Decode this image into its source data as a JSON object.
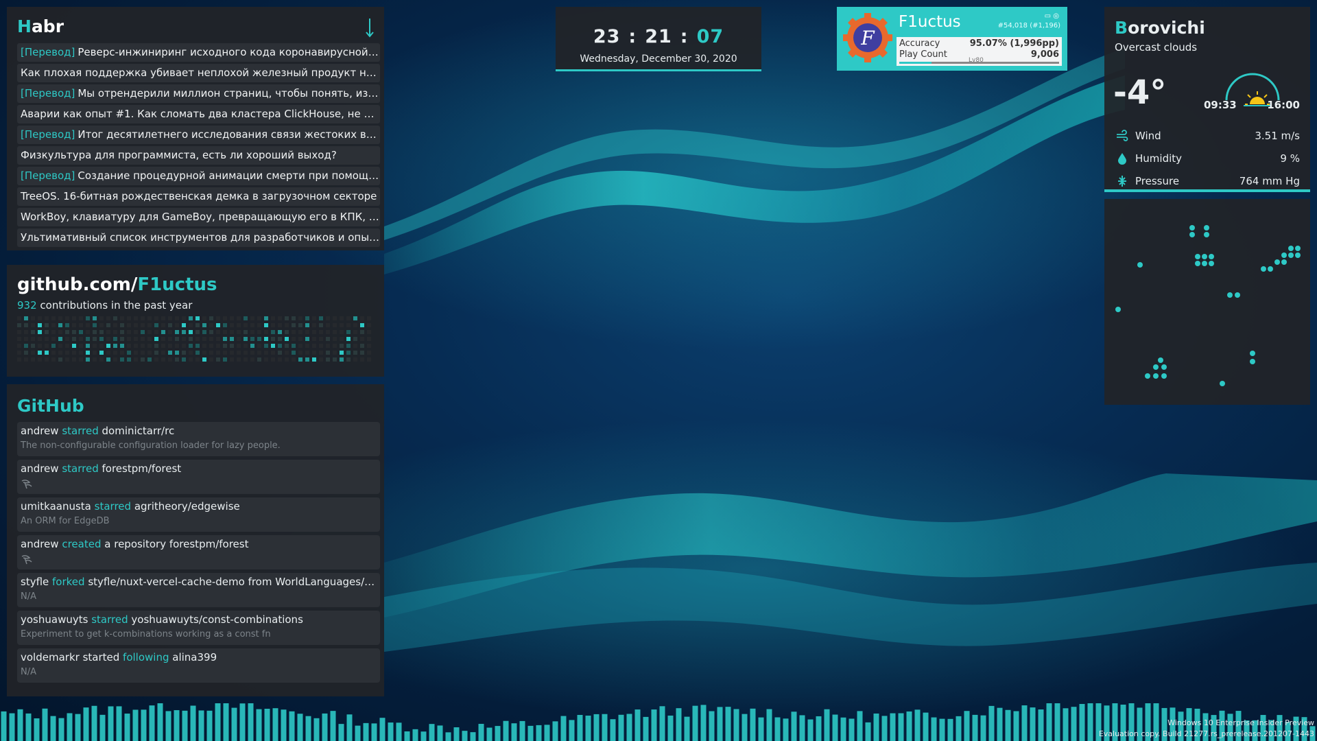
{
  "colors": {
    "accent": "#2ec9c6",
    "panel": "#212428",
    "item": "#2e3237",
    "muted": "#7d848a"
  },
  "habr": {
    "title_first": "H",
    "title_rest": "abr",
    "arrow_icon": "arrow-down-icon",
    "items": [
      {
        "tag": "[Перевод]",
        "text": "Реверс-инжиниринг исходного кода коронавирусной ва..."
      },
      {
        "tag": "",
        "text": "Как плохая поддержка убивает неплохой железный продукт на пр..."
      },
      {
        "tag": "[Перевод]",
        "text": "Мы отрендерили миллион страниц, чтобы понять, из-з..."
      },
      {
        "tag": "",
        "text": "Аварии как опыт #1. Как сломать два кластера ClickHouse, не уточ..."
      },
      {
        "tag": "[Перевод]",
        "text": "Итог десятилетнего исследования связи жестоких вид..."
      },
      {
        "tag": "",
        "text": "Физкультура для программиста, есть ли хороший выход?"
      },
      {
        "tag": "[Перевод]",
        "text": "Создание процедурной анимации смерти при помощи..."
      },
      {
        "tag": "",
        "text": "TreeOS. 16-битная рождественская демка в загрузочном секторе"
      },
      {
        "tag": "",
        "text": "WorkBoy, клавиатуру для GameBoy, превращающую его в КПК, на..."
      },
      {
        "tag": "",
        "text": "Ультимативный список инструментов для разработчиков и опытн..."
      }
    ]
  },
  "github_contrib": {
    "domain": "github.com/",
    "user": "F1uctus",
    "count": "932",
    "suffix": " contributions in the past year"
  },
  "github_feed": {
    "title_first": "Git",
    "title_second": "H",
    "title_rest": "ub",
    "items": [
      {
        "actor": "andrew",
        "verb": "starred",
        "target": "dominictarr/rc",
        "desc": "The non-configurable configuration loader for lazy people.",
        "icon": ""
      },
      {
        "actor": "andrew",
        "verb": "starred",
        "target": "forestpm/forest",
        "desc": "",
        "icon": "tree-icon"
      },
      {
        "actor": "umitkaanusta",
        "verb": "starred",
        "target": "agritheory/edgewise",
        "desc": "An ORM for EdgeDB",
        "icon": ""
      },
      {
        "actor": "andrew",
        "verb": "created",
        "target": "a repository forestpm/forest",
        "desc": "",
        "icon": "tree-icon"
      },
      {
        "actor": "styfle",
        "verb": "forked",
        "target": "styfle/nuxt-vercel-cache-demo from WorldLanguages/n...",
        "desc": "N/A",
        "icon": ""
      },
      {
        "actor": "yoshuawuyts",
        "verb": "starred",
        "target": "yoshuawuyts/const-combinations",
        "desc": "Experiment to get k-combinations working as a const fn",
        "icon": ""
      },
      {
        "actor": "voldemarkr started",
        "verb": "following",
        "target": "alina399",
        "desc": "N/A",
        "icon": ""
      }
    ]
  },
  "clock": {
    "hours": "23",
    "minutes": "21",
    "seconds": "07",
    "separator": ":",
    "date": "Wednesday, December 30, 2020"
  },
  "osu": {
    "username": "F1uctus",
    "rank": "#54,018 (#1,196)",
    "flags": "▭ ◎",
    "avatar_letter": "F",
    "accuracy_label": "Accuracy",
    "accuracy_value": "95.07% (1,996pp)",
    "playcount_label": "Play Count",
    "playcount_value": "9,006",
    "level": "Lv80",
    "level_progress": 0.2
  },
  "weather": {
    "city_first": "B",
    "city_rest": "orovichi",
    "condition": "Overcast clouds",
    "temp": "-4°",
    "sunrise": "09:33",
    "sunset": "16:00",
    "rows": [
      {
        "icon": "wind-icon",
        "label": "Wind",
        "value": "3.51 m/s"
      },
      {
        "icon": "humidity-drop-icon",
        "label": "Humidity",
        "value": "9 %"
      },
      {
        "icon": "pressure-icon",
        "label": "Pressure",
        "value": "764 mm Hg"
      }
    ]
  },
  "watermark": {
    "line1": "Windows 10 Enterprise Insider Preview",
    "line2": "Evaluation copy. Build 21277.rs_prerelease.201207-1443"
  }
}
